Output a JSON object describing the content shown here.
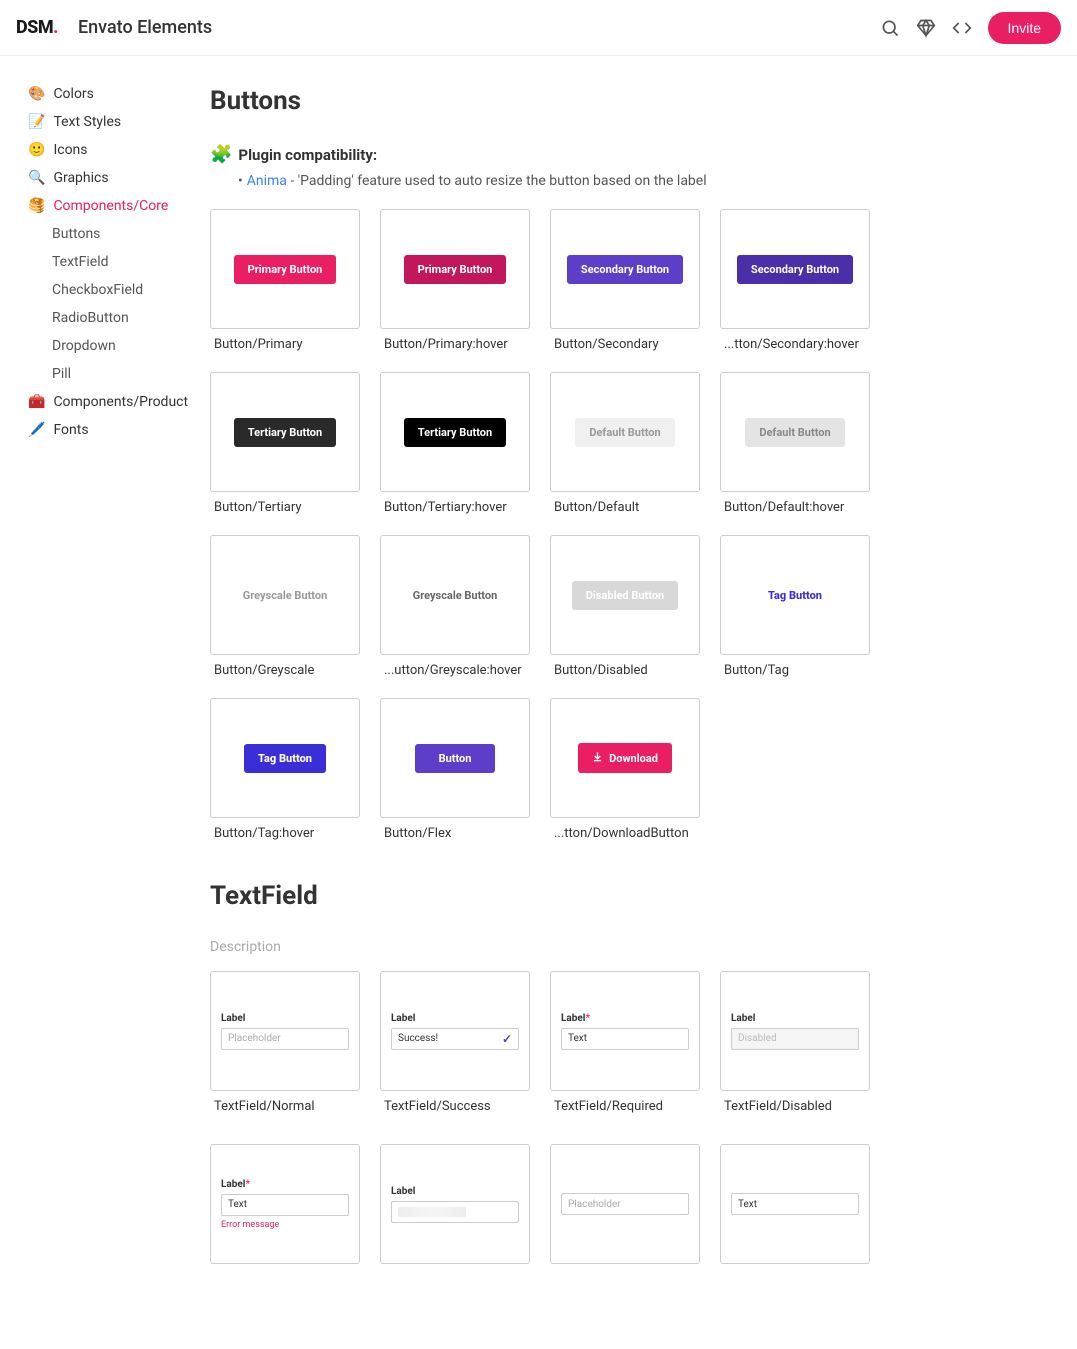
{
  "header": {
    "logo_text": "DSM",
    "logo_dot": ".",
    "app_title": "Envato Elements",
    "invite_label": "Invite"
  },
  "sidebar": {
    "items": [
      {
        "emoji": "🎨",
        "label": "Colors"
      },
      {
        "emoji": "📝",
        "label": "Text Styles"
      },
      {
        "emoji": "🙂",
        "label": "Icons"
      },
      {
        "emoji": "🔍",
        "label": "Graphics"
      },
      {
        "emoji": "🥞",
        "label": "Components/Core"
      },
      {
        "emoji": "🧰",
        "label": "Components/Product"
      },
      {
        "emoji": "🖊️",
        "label": "Fonts"
      }
    ],
    "subitems": [
      {
        "label": "Buttons"
      },
      {
        "label": "TextField"
      },
      {
        "label": "CheckboxField"
      },
      {
        "label": "RadioButton"
      },
      {
        "label": "Dropdown"
      },
      {
        "label": "Pill"
      }
    ]
  },
  "sections": {
    "buttons": {
      "title": "Buttons",
      "compat_title": "Plugin compatibility:",
      "compat_emoji": "🧩",
      "anima": "Anima",
      "anima_desc": " - 'Padding' feature used to auto resize the button based on the label"
    },
    "textfield": {
      "title": "TextField",
      "desc": "Description"
    }
  },
  "buttons": [
    {
      "text": "Primary Button",
      "cls": "primary",
      "label": "Button/Primary"
    },
    {
      "text": "Primary Button",
      "cls": "primary-hover",
      "label": "Button/Primary:hover"
    },
    {
      "text": "Secondary Button",
      "cls": "secondary",
      "label": "Button/Secondary"
    },
    {
      "text": "Secondary Button",
      "cls": "secondary-hover",
      "label": "tton/Secondary:hover",
      "ellip": true
    },
    {
      "text": "Tertiary Button",
      "cls": "tertiary",
      "label": "Button/Tertiary"
    },
    {
      "text": "Tertiary Button",
      "cls": "tertiary-hover",
      "label": "Button/Tertiary:hover"
    },
    {
      "text": "Default Button",
      "cls": "default",
      "label": "Button/Default"
    },
    {
      "text": "Default Button",
      "cls": "default-hover",
      "label": "Button/Default:hover"
    },
    {
      "text": "Greyscale Button",
      "cls": "greyscale",
      "label": "Button/Greyscale"
    },
    {
      "text": "Greyscale Button",
      "cls": "greyscale-hover",
      "label": "utton/Greyscale:hover",
      "ellip": true
    },
    {
      "text": "Disabled Button",
      "cls": "disabled",
      "label": "Button/Disabled"
    },
    {
      "text": "Tag Button",
      "cls": "tag",
      "label": "Button/Tag"
    },
    {
      "text": "Tag Button",
      "cls": "tag-hover",
      "label": "Button/Tag:hover"
    },
    {
      "text": "Button",
      "cls": "flex",
      "label": "Button/Flex"
    },
    {
      "text": "Download",
      "cls": "download",
      "label": "tton/DownloadButton",
      "ellip": true,
      "icon": true
    }
  ],
  "textfields": [
    {
      "label": "Label",
      "value": "Placeholder",
      "style": "ph",
      "name": "TextField/Normal"
    },
    {
      "label": "Label",
      "value": "Success!",
      "style": "success",
      "name": "TextField/Success",
      "check": true
    },
    {
      "label": "Label",
      "value": "Text",
      "style": "",
      "name": "TextField/Required",
      "req": true
    },
    {
      "label": "Label",
      "value": "Disabled",
      "style": "disabled",
      "name": "TextField/Disabled"
    }
  ],
  "textfields2": [
    {
      "label": "Label",
      "value": "Text",
      "req": true,
      "error": "Error message"
    },
    {
      "label": "Label",
      "skel": true
    },
    {
      "nolabel": true,
      "value": "Placeholder",
      "style": "ph"
    },
    {
      "nolabel": true,
      "value": "Text",
      "style": ""
    }
  ]
}
